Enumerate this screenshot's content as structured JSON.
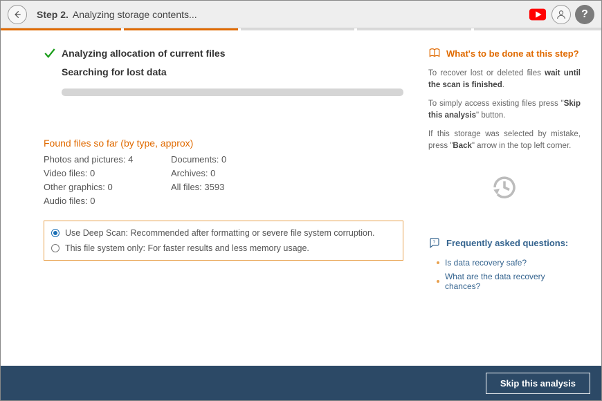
{
  "header": {
    "step_label": "Step 2.",
    "step_text": "Analyzing storage contents..."
  },
  "main": {
    "status1": "Analyzing allocation of current files",
    "status2": "Searching for lost data",
    "found_heading": "Found files so far (by type, approx)",
    "counts_col1": [
      "Photos and pictures: 4",
      "Video files: 0",
      "Other graphics: 0",
      "Audio files: 0"
    ],
    "counts_col2": [
      "Documents: 0",
      "Archives: 0",
      "All files: 3593"
    ],
    "scan_options": {
      "deep": "Use Deep Scan: Recommended after formatting or severe file system corruption.",
      "fs_only": "This file system only: For faster results and less memory usage."
    }
  },
  "side": {
    "title": "What's to be done at this step?",
    "p1_a": "To recover lost or deleted files ",
    "p1_b": "wait until the scan is finished",
    "p1_c": ".",
    "p2_a": "To simply access existing files press \"",
    "p2_b": "Skip this analysis",
    "p2_c": "\" button.",
    "p3_a": "If this storage was selected by mistake, press \"",
    "p3_b": "Back",
    "p3_c": "\" arrow in the top left corner.",
    "faq_title": "Frequently asked questions:",
    "faq_items": [
      "Is data recovery safe?",
      "What are the data recovery chances?"
    ]
  },
  "footer": {
    "skip_label": "Skip this analysis"
  }
}
